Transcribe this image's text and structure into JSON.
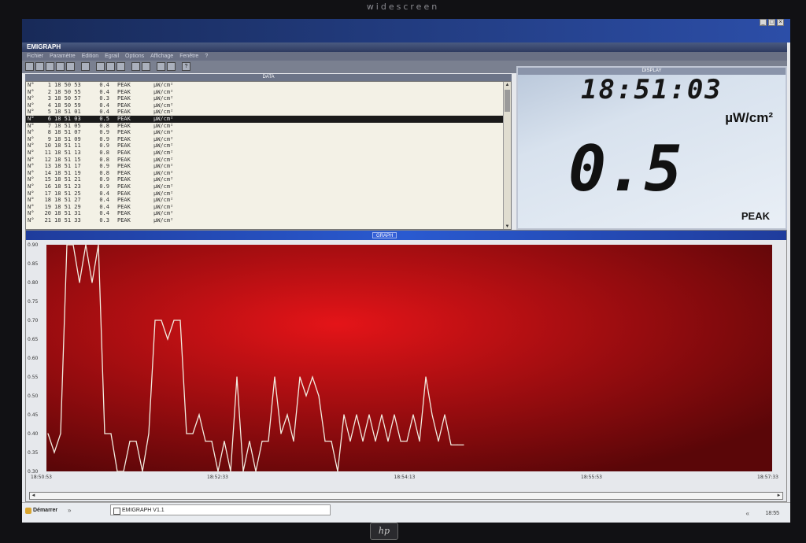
{
  "monitor": {
    "brand_top": "widescreen"
  },
  "window": {
    "title": "EMIGRAPH",
    "menu": [
      "Fichier",
      "Paramètre",
      "Edition",
      "Egrail",
      "Options",
      "Affichage",
      "Fenêtre",
      "?"
    ],
    "toolbar_help": "?"
  },
  "data_panel": {
    "title": "DATA",
    "selected_index": 5,
    "rows": [
      {
        "n": "N°",
        "i": "1",
        "time": "18 50 53",
        "value": "0.4",
        "mode": "PEAK",
        "unit": "µW/cm²"
      },
      {
        "n": "N°",
        "i": "2",
        "time": "18 50 55",
        "value": "0.4",
        "mode": "PEAK",
        "unit": "µW/cm²"
      },
      {
        "n": "N°",
        "i": "3",
        "time": "18 50 57",
        "value": "0.3",
        "mode": "PEAK",
        "unit": "µW/cm²"
      },
      {
        "n": "N°",
        "i": "4",
        "time": "18 50 59",
        "value": "0.4",
        "mode": "PEAK",
        "unit": "µW/cm²"
      },
      {
        "n": "N°",
        "i": "5",
        "time": "18 51 01",
        "value": "0.4",
        "mode": "PEAK",
        "unit": "µW/cm²"
      },
      {
        "n": "N°",
        "i": "6",
        "time": "18 51 03",
        "value": "0.5",
        "mode": "PEAK",
        "unit": "µW/cm²"
      },
      {
        "n": "N°",
        "i": "7",
        "time": "18 51 05",
        "value": "0.8",
        "mode": "PEAK",
        "unit": "µW/cm²"
      },
      {
        "n": "N°",
        "i": "8",
        "time": "18 51 07",
        "value": "0.9",
        "mode": "PEAK",
        "unit": "µW/cm²"
      },
      {
        "n": "N°",
        "i": "9",
        "time": "18 51 09",
        "value": "0.9",
        "mode": "PEAK",
        "unit": "µW/cm²"
      },
      {
        "n": "N°",
        "i": "10",
        "time": "18 51 11",
        "value": "0.9",
        "mode": "PEAK",
        "unit": "µW/cm²"
      },
      {
        "n": "N°",
        "i": "11",
        "time": "18 51 13",
        "value": "0.8",
        "mode": "PEAK",
        "unit": "µW/cm²"
      },
      {
        "n": "N°",
        "i": "12",
        "time": "18 51 15",
        "value": "0.8",
        "mode": "PEAK",
        "unit": "µW/cm²"
      },
      {
        "n": "N°",
        "i": "13",
        "time": "18 51 17",
        "value": "0.9",
        "mode": "PEAK",
        "unit": "µW/cm²"
      },
      {
        "n": "N°",
        "i": "14",
        "time": "18 51 19",
        "value": "0.8",
        "mode": "PEAK",
        "unit": "µW/cm²"
      },
      {
        "n": "N°",
        "i": "15",
        "time": "18 51 21",
        "value": "0.9",
        "mode": "PEAK",
        "unit": "µW/cm²"
      },
      {
        "n": "N°",
        "i": "16",
        "time": "18 51 23",
        "value": "0.9",
        "mode": "PEAK",
        "unit": "µW/cm²"
      },
      {
        "n": "N°",
        "i": "17",
        "time": "18 51 25",
        "value": "0.4",
        "mode": "PEAK",
        "unit": "µW/cm²"
      },
      {
        "n": "N°",
        "i": "18",
        "time": "18 51 27",
        "value": "0.4",
        "mode": "PEAK",
        "unit": "µW/cm²"
      },
      {
        "n": "N°",
        "i": "19",
        "time": "18 51 29",
        "value": "0.4",
        "mode": "PEAK",
        "unit": "µW/cm²"
      },
      {
        "n": "N°",
        "i": "20",
        "time": "18 51 31",
        "value": "0.4",
        "mode": "PEAK",
        "unit": "µW/cm²"
      },
      {
        "n": "N°",
        "i": "21",
        "time": "18 51 33",
        "value": "0.3",
        "mode": "PEAK",
        "unit": "µW/cm²"
      }
    ]
  },
  "display_panel": {
    "title": "DISPLAY",
    "time": "18:51:03",
    "unit": "µW/cm²",
    "value": "0.5",
    "mode": "PEAK"
  },
  "graph_panel": {
    "title": "GRAPH",
    "colors": {
      "plot_bg_center": "#e41418",
      "plot_bg_edge": "#5a0608",
      "line": "#f2ece0"
    }
  },
  "chart_data": {
    "type": "line",
    "title": "",
    "xlabel": "",
    "ylabel": "",
    "ylim": [
      0.3,
      0.9
    ],
    "yticks": [
      "0.90",
      "0.85",
      "0.80",
      "0.75",
      "0.70",
      "0.65",
      "0.60",
      "0.55",
      "0.50",
      "0.45",
      "0.40",
      "0.35",
      "0.30"
    ],
    "xtick_labels": [
      "18:50:53",
      "18:52:33",
      "18:54:13",
      "18:55:53",
      "18:57:33"
    ],
    "grid": false,
    "series": [
      {
        "values": [
          0.4,
          0.35,
          0.4,
          0.9,
          0.9,
          0.8,
          0.9,
          0.8,
          0.9,
          0.4,
          0.4,
          0.3,
          0.3,
          0.38,
          0.38,
          0.3,
          0.4,
          0.7,
          0.7,
          0.65,
          0.7,
          0.7,
          0.4,
          0.4,
          0.45,
          0.38,
          0.38,
          0.3,
          0.38,
          0.3,
          0.55,
          0.3,
          0.38,
          0.3,
          0.38,
          0.38,
          0.55,
          0.4,
          0.45,
          0.38,
          0.55,
          0.5,
          0.55,
          0.5,
          0.38,
          0.38,
          0.3,
          0.45,
          0.38,
          0.45,
          0.38,
          0.45,
          0.38,
          0.45,
          0.38,
          0.45,
          0.38,
          0.38,
          0.45,
          0.38,
          0.55,
          0.45,
          0.38,
          0.45,
          0.37,
          0.37,
          0.37
        ]
      }
    ]
  },
  "taskbar": {
    "start": "Démarrer",
    "quick": "»",
    "task": "EMIGRAPH V1.1",
    "tray_arrows": "«",
    "clock": "18:55"
  }
}
